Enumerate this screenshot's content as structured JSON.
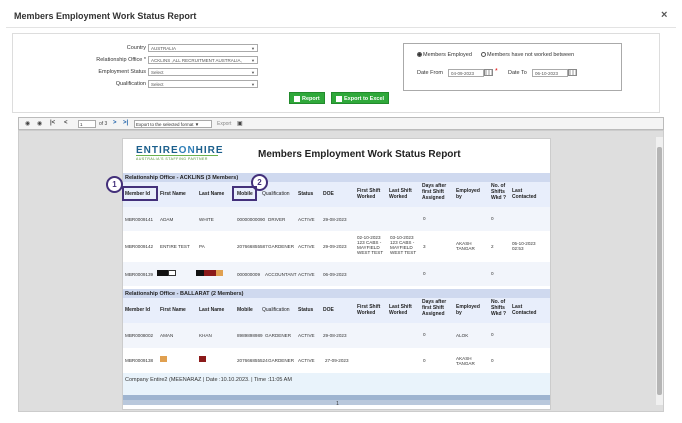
{
  "dialog": {
    "title": "Members Employment Work Status Report",
    "close_label": "×"
  },
  "filters": {
    "country": {
      "label": "Country",
      "value": "AUSTRALIA"
    },
    "relationship_office": {
      "label": "Relationship Office",
      "required_mark": "*",
      "value": "ACKLINS ,ALL RECRUITMENT AUSTRALIA,"
    },
    "employment_status": {
      "label": "Employment Status",
      "value": "Select"
    },
    "qualification": {
      "label": "Qualification",
      "value": "Select"
    },
    "employed_option": "Members Employed",
    "not_worked_option": "Members have not worked between",
    "date_from_label": "Date From",
    "date_from": "04-09-2023",
    "date_from_required": "*",
    "date_to_label": "Date To",
    "date_to": "06-10-2023",
    "report_button": "Report",
    "export_excel_button": "Export to Excel"
  },
  "toolbar": {
    "page": "1",
    "of_pages": "of 3",
    "format_select": "Export to the selected format",
    "export_label": "Export"
  },
  "report": {
    "logo_text_1": "ENTIRE",
    "logo_text_2": "ON",
    "logo_text_3": "HIRE",
    "logo_tagline": "AUSTRALIA'S STAFFING PARTNER",
    "title": "Members Employment Work Status Report",
    "columns": {
      "member_id": "Member Id",
      "first_name": "First Name",
      "last_name": "Last Name",
      "mobile": "Mobile",
      "qualification": "Qualification",
      "status": "Status",
      "doe": "DOE",
      "first_shift": "First Shift Worked",
      "last_shift": "Last Shift Worked",
      "days_after": "Days after first Shift Assigned",
      "employed_by": "Employed by",
      "no_shifts": "No. of Shifts Wkd ?",
      "last_contacted": "Last Contacted"
    },
    "groups": [
      {
        "title": "Relationship Office - ACKLINS (3 Members)",
        "rows": [
          {
            "member_id": "MBR0009141",
            "first_name": "ADAM",
            "last_name": "WHITE",
            "mobile": "00000000090",
            "qualification": "DRIVER",
            "status": "ACTIVE",
            "doe": "29-08-2023",
            "first_shift": "",
            "last_shift": "",
            "days_after": "0",
            "employed_by": "",
            "no_shifts": "0",
            "last_contacted": ""
          },
          {
            "member_id": "MBR0009142",
            "first_name": "ENTIRE TEST",
            "last_name": "PA",
            "mobile": "207666855587",
            "qualification": "GARDENER",
            "status": "ACTIVE",
            "doe": "29-09-2023",
            "first_shift": "02-10-2023 123 CABS - MAYFIELD WEST TEST",
            "last_shift": "03-10-2023 123 CABS - MAYFIELD WEST TEST",
            "days_after": "3",
            "employed_by": "AKASH TANGAR",
            "no_shifts": "2",
            "last_contacted": "05-10-2023 02:53"
          },
          {
            "member_id": "MBR0009139",
            "first_name": "",
            "last_name": "",
            "mobile": "000000009",
            "qualification": "ACCOUNTANT",
            "status": "ACTIVE",
            "doe": "06-09-2023",
            "first_shift": "",
            "last_shift": "",
            "days_after": "0",
            "employed_by": "",
            "no_shifts": "0",
            "last_contacted": ""
          }
        ]
      },
      {
        "title": "Relationship Office - BALLARAT (2 Members)",
        "rows": [
          {
            "member_id": "MBR0008002",
            "first_name": "AMAN",
            "last_name": "KHAN",
            "mobile": "8989898989",
            "qualification": "GARDENER",
            "status": "ACTIVE",
            "doe": "29-08-2023",
            "first_shift": "",
            "last_shift": "",
            "days_after": "0",
            "employed_by": "ALOK",
            "no_shifts": "0",
            "last_contacted": ""
          },
          {
            "member_id": "MBR0009138",
            "first_name": "",
            "last_name": "",
            "mobile": "207666855524",
            "qualification": "GARDENER",
            "status": "ACTIVE",
            "doe": "27-09-2023",
            "first_shift": "",
            "last_shift": "",
            "days_after": "0",
            "employed_by": "AKASH TANGAR",
            "no_shifts": "0",
            "last_contacted": ""
          }
        ]
      }
    ],
    "footer": "Company  Entire2 (MEENARAZ | Date :10.10.2023. | Time :11:05 AM",
    "page_number": "1"
  },
  "annotations": {
    "one": "1",
    "two": "2"
  }
}
